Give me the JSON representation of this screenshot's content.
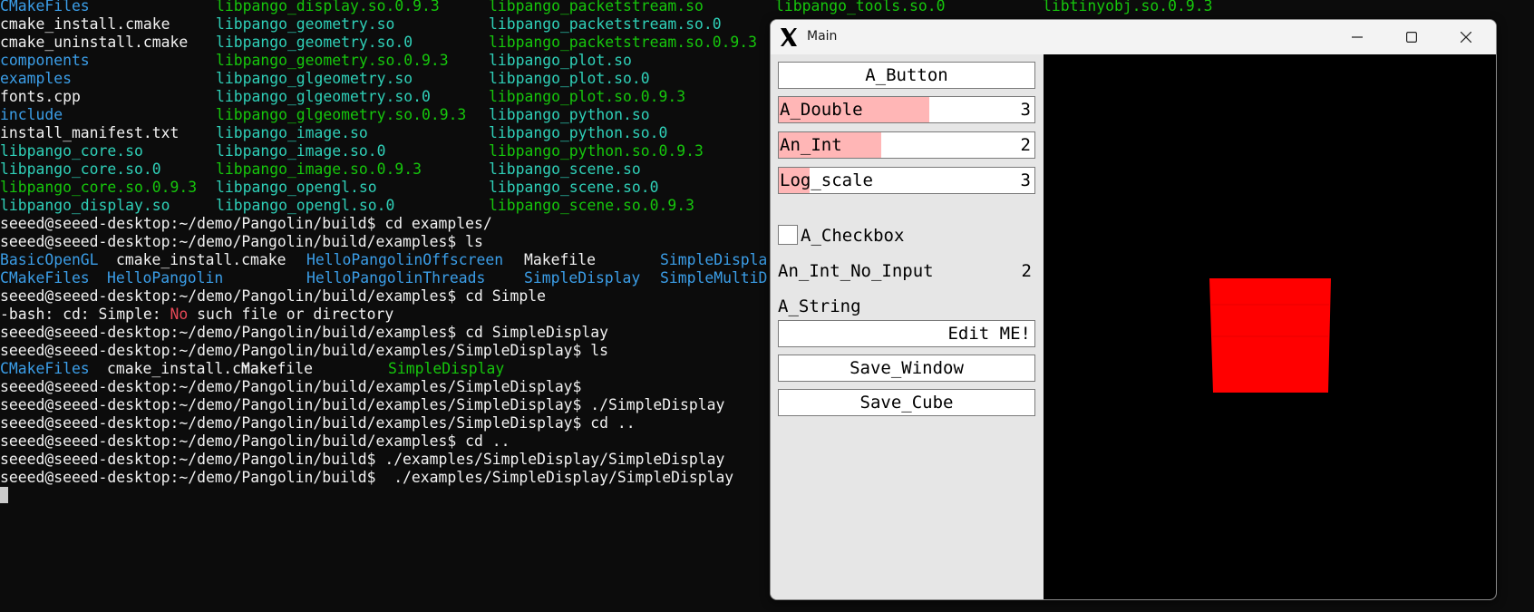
{
  "terminal": {
    "lines": [
      {
        "segments": [
          {
            "t": "CMakeFiles",
            "c": "dir"
          },
          {
            "t": "libpango_display.so.0.9.3",
            "c": "exe"
          },
          {
            "t": "libpango_packetstream.so",
            "c": "exe"
          },
          {
            "t": "libpango_tools.so.0",
            "c": "exe"
          },
          {
            "t": "libtinyobj.so.0.9.3",
            "c": "exe"
          }
        ]
      },
      {
        "segments": [
          {
            "t": "cmake_install.cmake",
            "c": "file"
          },
          {
            "t": "libpango_geometry.so",
            "c": "lnk"
          },
          {
            "t": "libpango_packetstream.so.0",
            "c": "lnk"
          }
        ]
      },
      {
        "segments": [
          {
            "t": "cmake_uninstall.cmake",
            "c": "file"
          },
          {
            "t": "libpango_geometry.so.0",
            "c": "lnk"
          },
          {
            "t": "libpango_packetstream.so.0.9.3",
            "c": "exe"
          }
        ]
      },
      {
        "segments": [
          {
            "t": "components",
            "c": "dir"
          },
          {
            "t": "libpango_geometry.so.0.9.3",
            "c": "exe"
          },
          {
            "t": "libpango_plot.so",
            "c": "lnk"
          }
        ]
      },
      {
        "segments": [
          {
            "t": "examples",
            "c": "dir"
          },
          {
            "t": "libpango_glgeometry.so",
            "c": "lnk"
          },
          {
            "t": "libpango_plot.so.0",
            "c": "lnk"
          }
        ]
      },
      {
        "segments": [
          {
            "t": "fonts.cpp",
            "c": "file"
          },
          {
            "t": "libpango_glgeometry.so.0",
            "c": "lnk"
          },
          {
            "t": "libpango_plot.so.0.9.3",
            "c": "exe"
          }
        ]
      },
      {
        "segments": [
          {
            "t": "include",
            "c": "dir"
          },
          {
            "t": "libpango_glgeometry.so.0.9.3",
            "c": "exe"
          },
          {
            "t": "libpango_python.so",
            "c": "lnk"
          }
        ]
      },
      {
        "segments": [
          {
            "t": "install_manifest.txt",
            "c": "file"
          },
          {
            "t": "libpango_image.so",
            "c": "lnk"
          },
          {
            "t": "libpango_python.so.0",
            "c": "lnk"
          }
        ]
      },
      {
        "segments": [
          {
            "t": "libpango_core.so",
            "c": "lnk"
          },
          {
            "t": "libpango_image.so.0",
            "c": "lnk"
          },
          {
            "t": "libpango_python.so.0.9.3",
            "c": "exe"
          }
        ]
      },
      {
        "segments": [
          {
            "t": "libpango_core.so.0",
            "c": "lnk"
          },
          {
            "t": "libpango_image.so.0.9.3",
            "c": "exe"
          },
          {
            "t": "libpango_scene.so",
            "c": "lnk"
          }
        ]
      },
      {
        "segments": [
          {
            "t": "libpango_core.so.0.9.3",
            "c": "exe"
          },
          {
            "t": "libpango_opengl.so",
            "c": "lnk"
          },
          {
            "t": "libpango_scene.so.0",
            "c": "lnk"
          }
        ]
      },
      {
        "segments": [
          {
            "t": "libpango_display.so",
            "c": "lnk"
          },
          {
            "t": "libpango_opengl.so.0",
            "c": "lnk"
          },
          {
            "t": "libpango_scene.so.0.9.3",
            "c": "exe"
          }
        ]
      },
      {
        "segments": [
          {
            "t": "seeed@seeed-desktop:~/demo/Pangolin/build$ cd examples/",
            "c": "file"
          }
        ]
      },
      {
        "segments": [
          {
            "t": "seeed@seeed-desktop:~/demo/Pangolin/build/examples$ ls",
            "c": "file"
          }
        ]
      },
      {
        "segments": [
          {
            "t": "BasicOpenGL",
            "c": "dir"
          },
          {
            "t": "cmake_install.cmake",
            "c": "file"
          },
          {
            "t": "HelloPangolinOffscreen",
            "c": "dir"
          },
          {
            "t": "Makefile",
            "c": "file"
          },
          {
            "t": "SimpleDispla",
            "c": "dir"
          }
        ]
      },
      {
        "segments": [
          {
            "t": "CMakeFiles",
            "c": "dir"
          },
          {
            "t": "HelloPangolin",
            "c": "dir"
          },
          {
            "t": "HelloPangolinThreads",
            "c": "dir"
          },
          {
            "t": "SimpleDisplay",
            "c": "dir"
          },
          {
            "t": "SimpleMultiD",
            "c": "dir"
          }
        ]
      },
      {
        "segments": [
          {
            "t": "seeed@seeed-desktop:~/demo/Pangolin/build/examples$ cd Simple",
            "c": "file"
          }
        ]
      },
      {
        "segments": [
          {
            "t": "-bash: cd: Simple: ",
            "c": "file"
          },
          {
            "t": "No",
            "c": "err"
          },
          {
            "t": " such file or directory",
            "c": "file"
          }
        ]
      },
      {
        "segments": [
          {
            "t": "seeed@seeed-desktop:~/demo/Pangolin/build/examples$ cd SimpleDisplay",
            "c": "file"
          }
        ]
      },
      {
        "segments": [
          {
            "t": "seeed@seeed-desktop:~/demo/Pangolin/build/examples/SimpleDisplay$ ls",
            "c": "file"
          }
        ]
      },
      {
        "segments": [
          {
            "t": "CMakeFiles",
            "c": "dir"
          },
          {
            "t": "cmake_install.cmake",
            "c": "file"
          },
          {
            "t": "Makefile",
            "c": "file"
          },
          {
            "t": "SimpleDisplay",
            "c": "exe"
          }
        ]
      },
      {
        "segments": [
          {
            "t": "seeed@seeed-desktop:~/demo/Pangolin/build/examples/SimpleDisplay$",
            "c": "file"
          }
        ]
      },
      {
        "segments": [
          {
            "t": "seeed@seeed-desktop:~/demo/Pangolin/build/examples/SimpleDisplay$ ./SimpleDisplay",
            "c": "file"
          }
        ]
      },
      {
        "segments": [
          {
            "t": "seeed@seeed-desktop:~/demo/Pangolin/build/examples/SimpleDisplay$ cd ..",
            "c": "file"
          }
        ]
      },
      {
        "segments": [
          {
            "t": "seeed@seeed-desktop:~/demo/Pangolin/build/examples$ cd ..",
            "c": "file"
          }
        ]
      },
      {
        "segments": [
          {
            "t": "seeed@seeed-desktop:~/demo/Pangolin/build$ ./examples/SimpleDisplay/SimpleDisplay",
            "c": "file"
          }
        ]
      },
      {
        "segments": [
          {
            "t": "seeed@seeed-desktop:~/demo/Pangolin/build$  ./examples/SimpleDisplay/SimpleDisplay",
            "c": "file"
          }
        ]
      }
    ]
  },
  "window": {
    "title": "Main",
    "app_icon": "x11-icon",
    "controls": [
      "minimize-icon",
      "maximize-icon",
      "close-icon"
    ]
  },
  "panel": {
    "a_button": "A_Button",
    "a_double": {
      "label": "A_Double",
      "value": "3",
      "fill_fraction": 0.59
    },
    "an_int": {
      "label": "An_Int",
      "value": "2",
      "fill_fraction": 0.4
    },
    "log_scale": {
      "label": "Log_scale",
      "value": "3",
      "fill_fraction": 0.12
    },
    "a_checkbox": {
      "label": "A_Checkbox",
      "checked": false
    },
    "an_int_no_input": {
      "label": "An_Int_No_Input",
      "value": "2"
    },
    "a_string": {
      "label": "A_String",
      "value": "Edit ME!"
    },
    "save_window": "Save_Window",
    "save_cube": "Save_Cube"
  },
  "viewport": {
    "background": "#000000",
    "cube_color": "#ff0000"
  },
  "colors": {
    "terminal_bg": "#0c0c0c",
    "dir": "#3b9ee8",
    "exe": "#16c60c",
    "lnk": "#2fd0b8",
    "err": "#e74856",
    "slider_fill": "#ffb6b6"
  }
}
